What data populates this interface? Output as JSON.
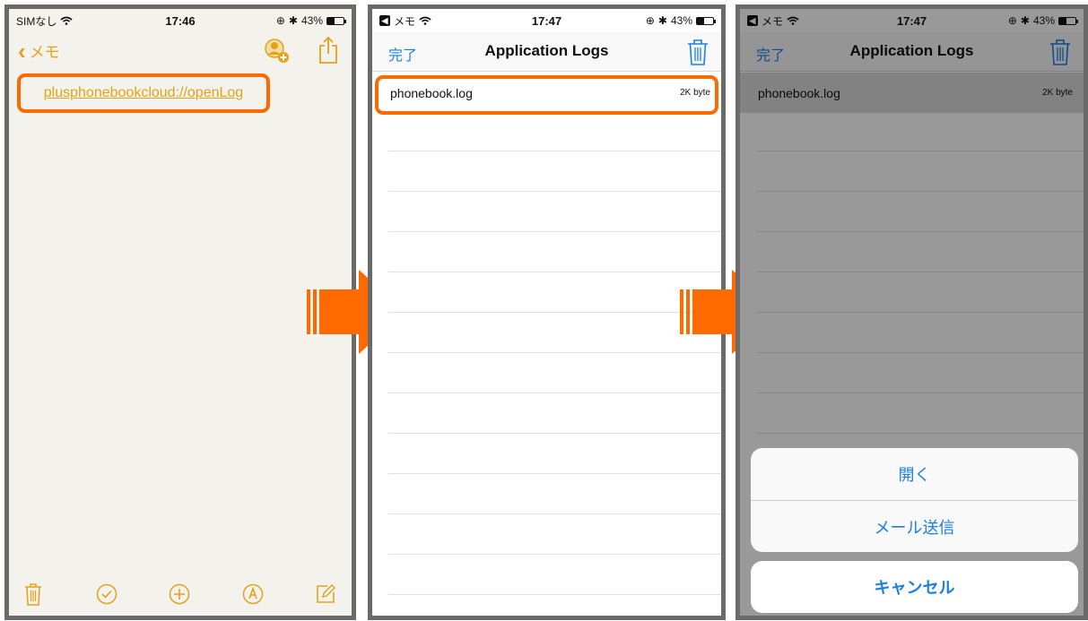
{
  "colors": {
    "accent_orange": "#ff6a00",
    "notes_yellow": "#e3a21a",
    "ios_blue": "#1a7fe6"
  },
  "screen1": {
    "status": {
      "carrier": "SIMなし",
      "time": "17:46",
      "battery": "43%",
      "battery_level": 0.43
    },
    "nav": {
      "back_label": "メモ"
    },
    "note": {
      "link_text": "plusphonebookcloud://openLog"
    },
    "toolbar_icons": [
      "trash-icon",
      "checklist-icon",
      "add-icon",
      "sketch-icon",
      "compose-icon"
    ]
  },
  "screen2": {
    "status": {
      "carrier": "メモ",
      "time": "17:47",
      "battery": "43%",
      "battery_level": 0.43
    },
    "nav": {
      "done_label": "完了",
      "title": "Application Logs"
    },
    "log_files": [
      {
        "name": "phonebook.log",
        "size": "2K byte"
      }
    ]
  },
  "screen3": {
    "status": {
      "carrier": "メモ",
      "time": "17:47",
      "battery": "43%",
      "battery_level": 0.43
    },
    "nav": {
      "done_label": "完了",
      "title": "Application Logs"
    },
    "log_files": [
      {
        "name": "phonebook.log",
        "size": "2K byte"
      }
    ],
    "action_sheet": {
      "open_label": "開く",
      "mail_label": "メール送信",
      "cancel_label": "キャンセル"
    }
  }
}
